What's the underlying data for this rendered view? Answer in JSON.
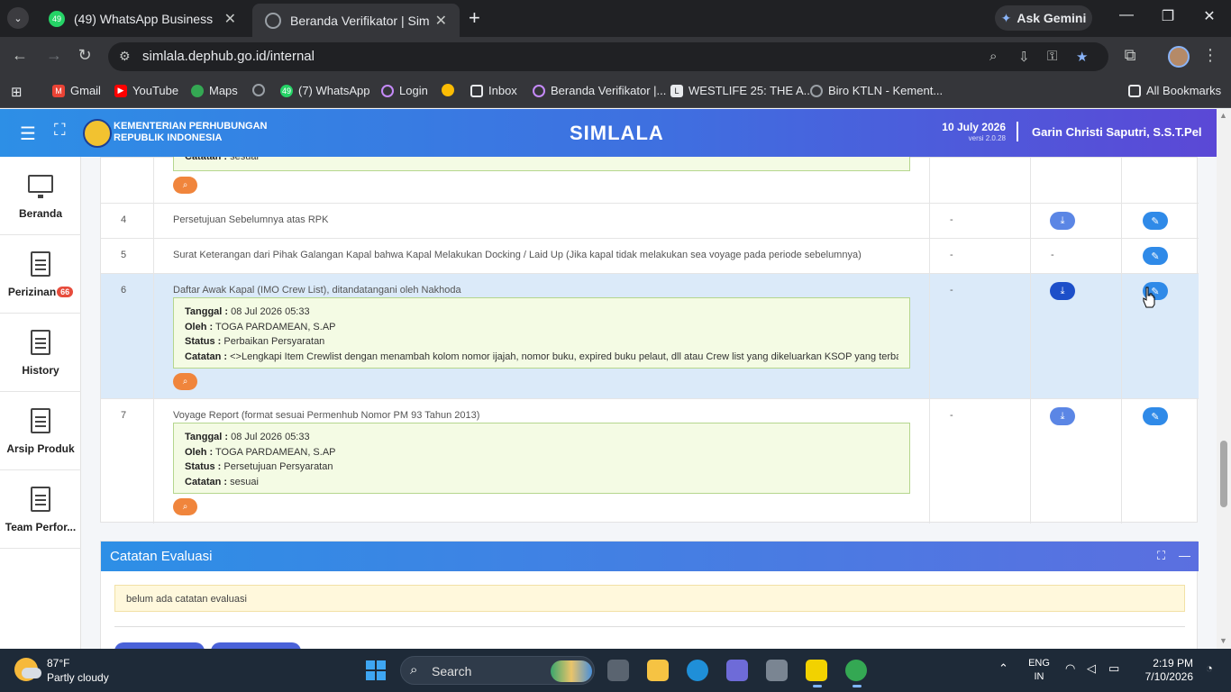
{
  "browser": {
    "tabs": [
      {
        "title": "(49) WhatsApp Business",
        "badge": "49"
      },
      {
        "title": "Beranda Verifikator | SimLala"
      }
    ],
    "gemini_label": "Ask Gemini",
    "url": "simlala.dephub.go.id/internal",
    "bookmarks": [
      {
        "label": "Gmail",
        "color": "#ea4335"
      },
      {
        "label": "YouTube",
        "color": "#ff0000"
      },
      {
        "label": "Maps",
        "color": "#34a853"
      },
      {
        "label": "",
        "color": "#9aa0a6"
      },
      {
        "label": "(7) WhatsApp",
        "color": "#25d366",
        "badge": "49"
      },
      {
        "label": "Login",
        "color": "#c58af9"
      },
      {
        "label": "",
        "color": "#fbbc04"
      },
      {
        "label": "Inbox",
        "color": "#e8eaed"
      },
      {
        "label": "Beranda Verifikator |...",
        "color": "#c58af9"
      },
      {
        "label": "WESTLIFE 25: THE A...",
        "color": "#e8eaed"
      },
      {
        "label": "Biro KTLN - Kement...",
        "color": "#9aa0a6"
      }
    ],
    "all_bookmarks": "All Bookmarks"
  },
  "header": {
    "ministry_line1": "KEMENTERIAN PERHUBUNGAN",
    "ministry_line2": "REPUBLIK INDONESIA",
    "brand": "SIMLALA",
    "date": "10 July 2026",
    "version": "versi 2.0.28",
    "user": "Garin Christi Saputri, S.S.T.Pel"
  },
  "sidebar": {
    "items": [
      {
        "label": "Beranda"
      },
      {
        "label": "Perizinan",
        "badge": "66"
      },
      {
        "label": "History"
      },
      {
        "label": "Arsip Produk"
      },
      {
        "label": "Team Perfor..."
      }
    ]
  },
  "table": {
    "top_note_partial": "sesuai",
    "rows": [
      {
        "no": "4",
        "document": "Persetujuan Sebelumnya atas RPK",
        "version": "-",
        "download": "icon"
      },
      {
        "no": "5",
        "document": "Surat Keterangan dari Pihak Galangan Kapal bahwa Kapal Melakukan Docking / Laid Up (Jika kapal tidak melakukan sea voyage pada periode sebelumnya)",
        "version": "-",
        "download": "-"
      },
      {
        "no": "6",
        "document": "Daftar Awak Kapal (IMO Crew List), ditandatangani oleh Nakhoda",
        "version": "-",
        "download": "icon",
        "note": {
          "tanggal": "08 Jul 2026 05:33",
          "oleh": "TOGA PARDAMEAN, S.AP",
          "status": "Perbaikan Persyaratan",
          "catatan": "<>Lengkapi Item Crewlist dengan menambah kolom nomor ijajah, nomor buku, expired buku pelaut, dll atau Crew list yang dikeluarkan KSOP yang terbaru;"
        }
      },
      {
        "no": "7",
        "document": "Voyage Report (format sesuai Permenhub Nomor PM 93 Tahun 2013)",
        "version": "-",
        "download": "icon",
        "note": {
          "tanggal": "08 Jul 2026 05:33",
          "oleh": "TOGA PARDAMEAN, S.AP",
          "status": "Persetujuan Persyaratan",
          "catatan": "sesuai"
        }
      }
    ],
    "labels": {
      "tanggal": "Tanggal :",
      "oleh": "Oleh :",
      "status": "Status :",
      "catatan": "Catatan :"
    }
  },
  "evaluation": {
    "title": "Catatan Evaluasi",
    "empty_text": "belum ada catatan evaluasi"
  },
  "taskbar": {
    "temp": "87°F",
    "condition": "Partly cloudy",
    "search": "Search",
    "lang1": "ENG",
    "lang2": "IN",
    "time": "2:19 PM",
    "date": "7/10/2026"
  }
}
